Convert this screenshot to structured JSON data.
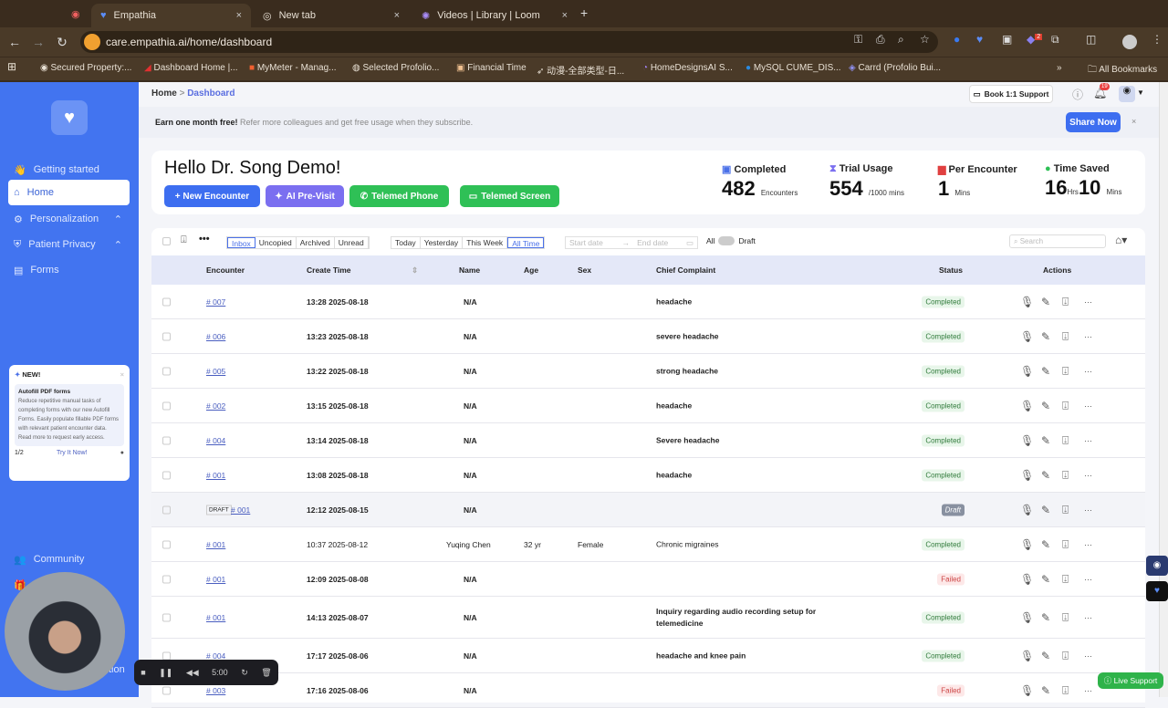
{
  "browser": {
    "tabs": [
      {
        "title": "Empathia",
        "active": true
      },
      {
        "title": "New tab"
      },
      {
        "title": "Videos | Library | Loom"
      }
    ],
    "url": "care.empathia.ai/home/dashboard",
    "bookmarks": [
      "Secured Property:...",
      "Dashboard Home |...",
      "MyMeter - Manag...",
      "Selected Profolio...",
      "Financial Time",
      "动漫-全部类型-日...",
      "HomeDesignsAI S...",
      "MySQL CUME_DIS...",
      "Carrd (Profolio Bui..."
    ],
    "all_bookmarks": "All Bookmarks",
    "ext_badge": "2"
  },
  "sidebar": {
    "items": [
      {
        "label": "Getting started",
        "icon": "👋"
      },
      {
        "label": "Home",
        "icon": "⌂",
        "active": true
      },
      {
        "label": "Personalization",
        "icon": "⚙",
        "chevron": true
      },
      {
        "label": "Patient Privacy",
        "icon": "⛨",
        "chevron": true
      },
      {
        "label": "Forms",
        "icon": "▤"
      }
    ],
    "community": "Community",
    "bottom_partial": "tion",
    "new_card": {
      "badge": "NEW!",
      "title": "Autofill PDF forms",
      "body": "Reduce repetitive manual tasks of completing forms with our new Autofill Forms. Easily populate fillable PDF forms with relevant patient encounter data. Read more to request early access.",
      "pager": "1/2",
      "cta": "Try It Now!"
    }
  },
  "header": {
    "crumb_home": "Home",
    "crumb_sep": ">",
    "crumb_current": "Dashboard",
    "support": "Book 1:1 Support",
    "notif_count": "19"
  },
  "banner": {
    "bold": "Earn one month free!",
    "text": "Refer more colleagues and get free usage when they subscribe.",
    "cta": "Share Now",
    "close": "×"
  },
  "greeting": "Hello Dr. Song Demo!",
  "actions": {
    "new": "+ New Encounter",
    "ai": "AI Pre-Visit",
    "phone": "Telemed Phone",
    "screen": "Telemed Screen"
  },
  "stats": {
    "completed": {
      "label": "Completed",
      "value": "482",
      "unit": "Encounters"
    },
    "trial": {
      "label": "Trial Usage",
      "value": "554",
      "unit": "/1000 mins"
    },
    "per": {
      "label": "Per Encounter",
      "value": "1",
      "unit": "Mins"
    },
    "saved": {
      "label": "Time Saved",
      "hrs": "16",
      "hrs_unit": "Hrs",
      "mins": "10",
      "mins_unit": "Mins"
    }
  },
  "toolbar": {
    "filters": [
      "Inbox",
      "Uncopied",
      "Archived",
      "Unread"
    ],
    "ranges": [
      "Today",
      "Yesterday",
      "This Week",
      "All Time"
    ],
    "start_ph": "Start date",
    "end_ph": "End date",
    "all": "All",
    "draft": "Draft",
    "search_ph": "Search"
  },
  "table": {
    "headers": [
      "Encounter",
      "Create Time",
      "Name",
      "Age",
      "Sex",
      "Chief Complaint",
      "Status",
      "Actions"
    ],
    "rows": [
      {
        "id": "# 007",
        "time": "13:28 2025-08-18",
        "name": "N/A",
        "age": "",
        "sex": "",
        "complaint": "headache",
        "status": "Completed"
      },
      {
        "id": "# 006",
        "time": "13:23 2025-08-18",
        "name": "N/A",
        "age": "",
        "sex": "",
        "complaint": "severe headache",
        "status": "Completed"
      },
      {
        "id": "# 005",
        "time": "13:22 2025-08-18",
        "name": "N/A",
        "age": "",
        "sex": "",
        "complaint": "strong headache",
        "status": "Completed"
      },
      {
        "id": "# 002",
        "time": "13:15 2025-08-18",
        "name": "N/A",
        "age": "",
        "sex": "",
        "complaint": "headache",
        "status": "Completed"
      },
      {
        "id": "# 004",
        "time": "13:14 2025-08-18",
        "name": "N/A",
        "age": "",
        "sex": "",
        "complaint": "Severe headache",
        "status": "Completed"
      },
      {
        "id": "# 001",
        "time": "13:08 2025-08-18",
        "name": "N/A",
        "age": "",
        "sex": "",
        "complaint": "headache",
        "status": "Completed"
      },
      {
        "id": "# 001",
        "draft_tag": "DRAFT",
        "time": "12:12 2025-08-15",
        "name": "N/A",
        "age": "",
        "sex": "",
        "complaint": "",
        "status": "Draft"
      },
      {
        "id": "# 001",
        "time": "10:37 2025-08-12",
        "name": "Yuqing Chen",
        "age": "32 yr",
        "sex": "Female",
        "complaint": "Chronic migraines",
        "status": "Completed"
      },
      {
        "id": "# 001",
        "time": "12:09 2025-08-08",
        "name": "N/A",
        "age": "",
        "sex": "",
        "complaint": "",
        "status": "Failed"
      },
      {
        "id": "# 001",
        "time": "14:13 2025-08-07",
        "name": "N/A",
        "age": "",
        "sex": "",
        "complaint": "Inquiry regarding audio recording setup for telemedicine",
        "status": "Completed"
      },
      {
        "id": "# 004",
        "time": "17:17 2025-08-06",
        "name": "N/A",
        "age": "",
        "sex": "",
        "complaint": "headache and knee pain",
        "status": "Completed"
      },
      {
        "id": "# 003",
        "time": "17:16 2025-08-06",
        "name": "N/A",
        "age": "",
        "sex": "",
        "complaint": "",
        "status": "Failed"
      }
    ]
  },
  "recorder": {
    "time": "5:00"
  },
  "live_support": "Live Support",
  "colors": {
    "sidebar": "#4274f0",
    "primary": "#3d6ef0",
    "ai": "#7b6ff0",
    "green": "#2fc056"
  }
}
